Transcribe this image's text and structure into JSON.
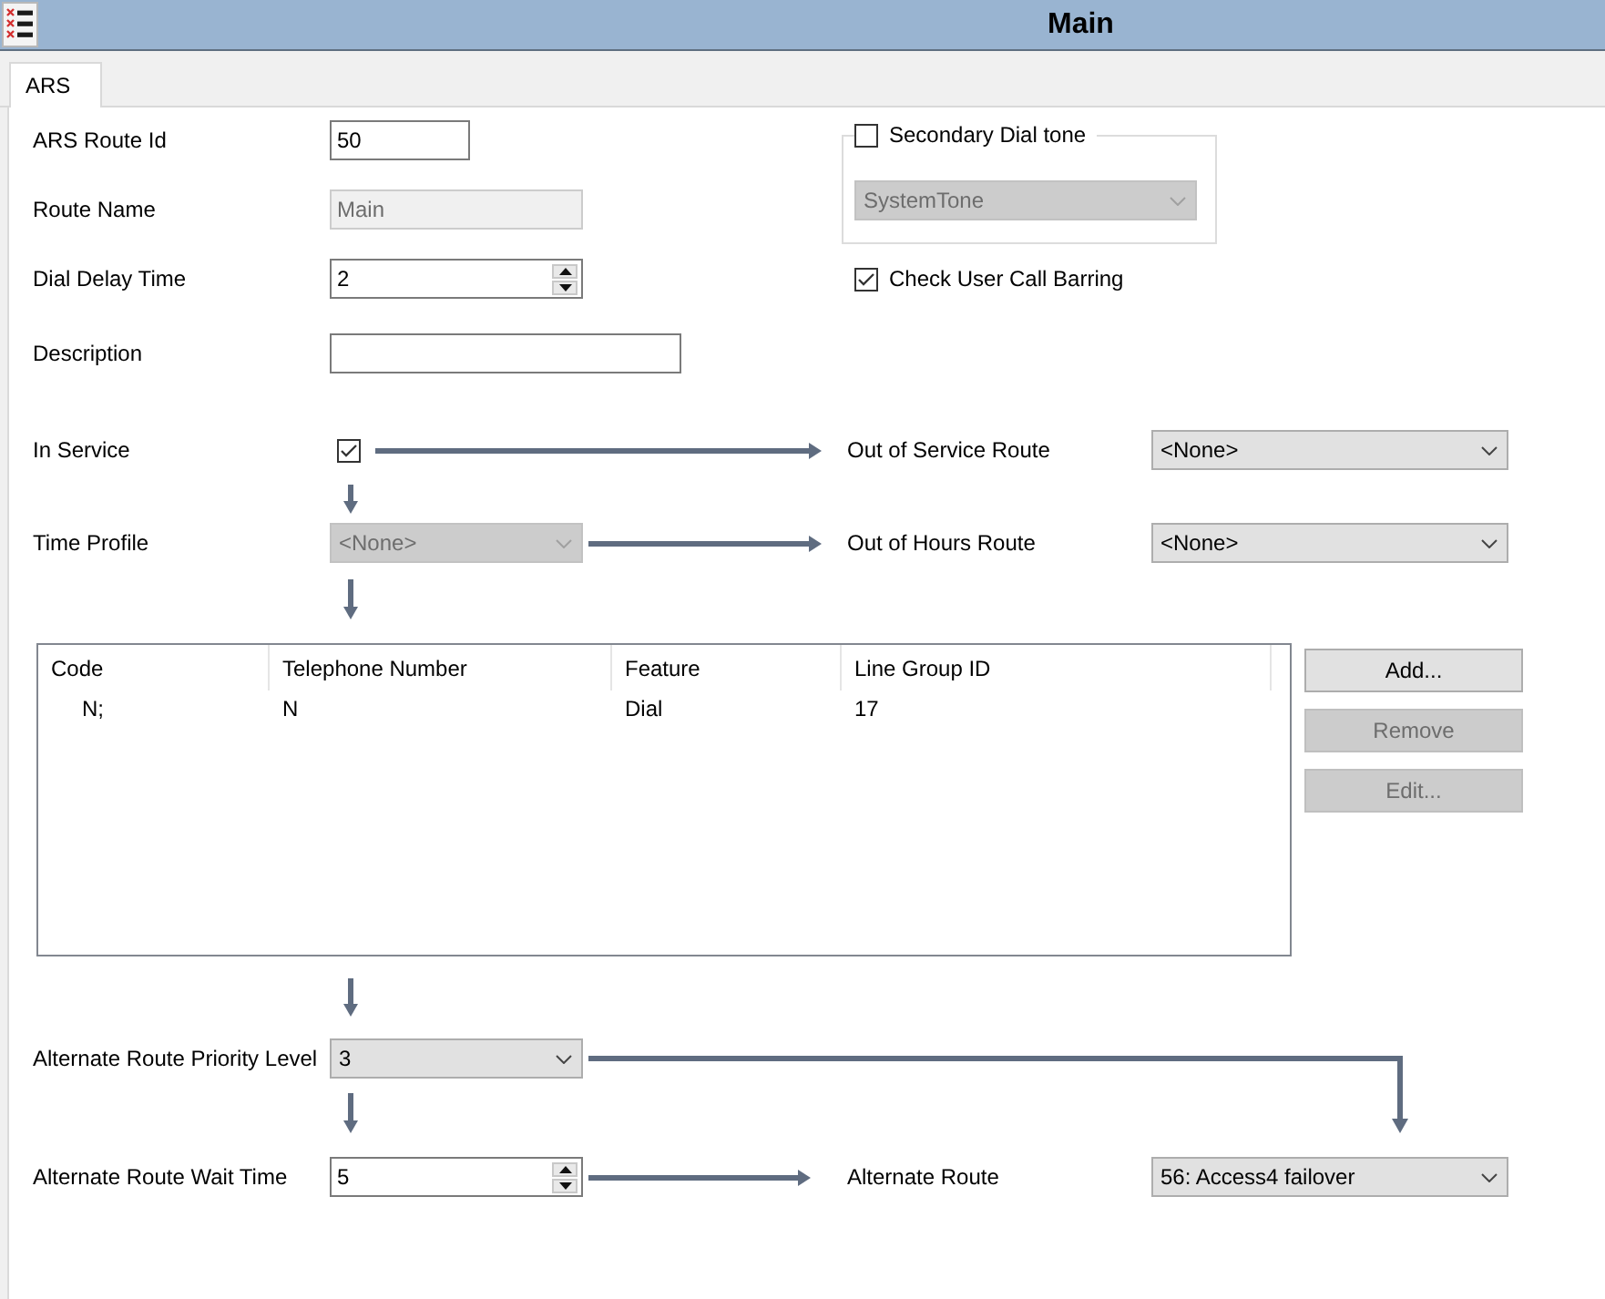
{
  "window": {
    "title": "Main"
  },
  "tabs": [
    {
      "label": "ARS",
      "selected": true
    }
  ],
  "fields": [
    {
      "kind": "text",
      "label": "ARS Route Id",
      "value": "50",
      "disabled": false
    },
    {
      "kind": "text",
      "label": "Route Name",
      "value": "Main",
      "disabled": true
    },
    {
      "kind": "spin",
      "label": "Dial Delay Time",
      "value": "2",
      "disabled": false
    },
    {
      "kind": "text",
      "label": "Description",
      "disabled": false
    }
  ],
  "secondary_dial_tone": {
    "label": "Secondary Dial tone",
    "checked": false,
    "tone": {
      "value": "SystemTone",
      "disabled": true
    }
  },
  "check_user_call_barring": {
    "label": "Check User Call Barring",
    "checked": true
  },
  "in_service": {
    "label": "In Service",
    "checked": true,
    "route_label": "Out of Service Route",
    "route": "<None>"
  },
  "time_profile": {
    "label": "Time Profile",
    "value": "<None>",
    "disabled": true,
    "route_label": "Out of Hours Route",
    "route": "<None>"
  },
  "table": {
    "columns": [
      "Code",
      "Telephone Number",
      "Feature",
      "Line Group ID"
    ],
    "rows": [
      [
        "N;",
        "N",
        "Dial",
        "17"
      ]
    ]
  },
  "buttons": [
    {
      "label": "Add...",
      "disabled": false
    },
    {
      "label": "Remove",
      "disabled": true
    },
    {
      "label": "Edit...",
      "disabled": true
    }
  ],
  "alternate_priority": {
    "label": "Alternate Route Priority Level",
    "value": "3"
  },
  "alternate_wait": {
    "label": "Alternate Route Wait Time",
    "value": "5",
    "route_label": "Alternate Route",
    "route": "56: Access4 failover"
  }
}
